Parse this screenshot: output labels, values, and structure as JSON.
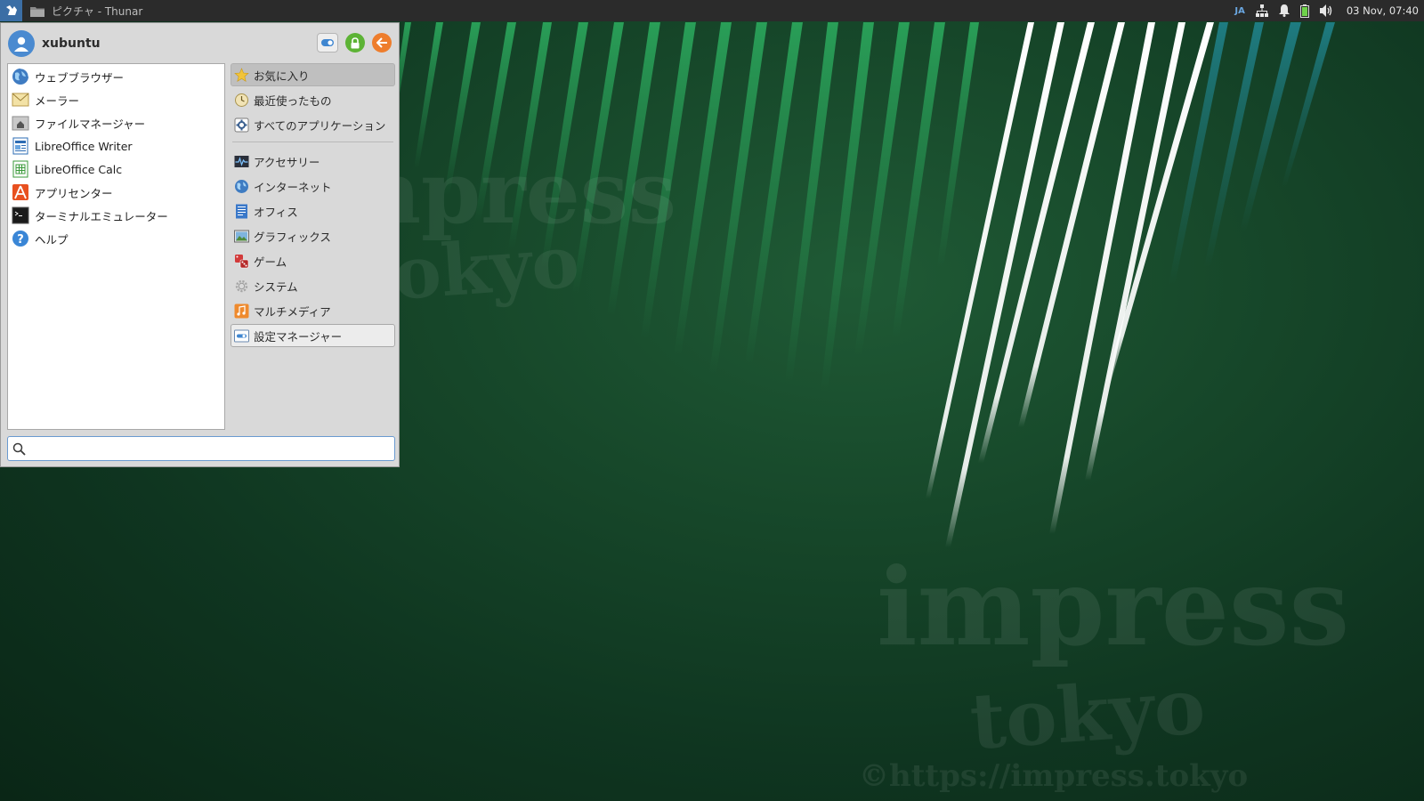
{
  "panel": {
    "task_title": "ピクチャ - Thunar",
    "input_method": "JA",
    "clock": "03 Nov, 07:40"
  },
  "menu": {
    "username": "xubuntu",
    "favorites": [
      {
        "label": "ウェブブラウザー",
        "icon": "web-browser-icon"
      },
      {
        "label": "メーラー",
        "icon": "mail-icon"
      },
      {
        "label": "ファイルマネージャー",
        "icon": "file-manager-icon"
      },
      {
        "label": "LibreOffice Writer",
        "icon": "writer-icon"
      },
      {
        "label": "LibreOffice Calc",
        "icon": "calc-icon"
      },
      {
        "label": "アプリセンター",
        "icon": "app-center-icon"
      },
      {
        "label": "ターミナルエミュレーター",
        "icon": "terminal-icon"
      },
      {
        "label": "ヘルプ",
        "icon": "help-icon"
      }
    ],
    "categories_top": [
      {
        "label": "お気に入り",
        "icon": "star-icon"
      },
      {
        "label": "最近使ったもの",
        "icon": "recent-icon"
      },
      {
        "label": "すべてのアプリケーション",
        "icon": "all-apps-icon"
      }
    ],
    "categories": [
      {
        "label": "アクセサリー",
        "icon": "accessories-icon"
      },
      {
        "label": "インターネット",
        "icon": "internet-icon"
      },
      {
        "label": "オフィス",
        "icon": "office-icon"
      },
      {
        "label": "グラフィックス",
        "icon": "graphics-icon"
      },
      {
        "label": "ゲーム",
        "icon": "games-icon"
      },
      {
        "label": "システム",
        "icon": "system-icon"
      },
      {
        "label": "マルチメディア",
        "icon": "multimedia-icon"
      },
      {
        "label": "設定マネージャー",
        "icon": "settings-manager-icon"
      }
    ],
    "search_placeholder": ""
  },
  "wallpaper": {
    "watermark_1": "impress",
    "watermark_2": "tokyo",
    "watermark_3": "©https://impress.tokyo"
  },
  "colors": {
    "panel_bg": "#2b2b2b",
    "menu_bg": "#d9d9d9",
    "accent": "#3b6ea5",
    "lock_green": "#5db335",
    "logout_orange": "#ee7d2c"
  }
}
